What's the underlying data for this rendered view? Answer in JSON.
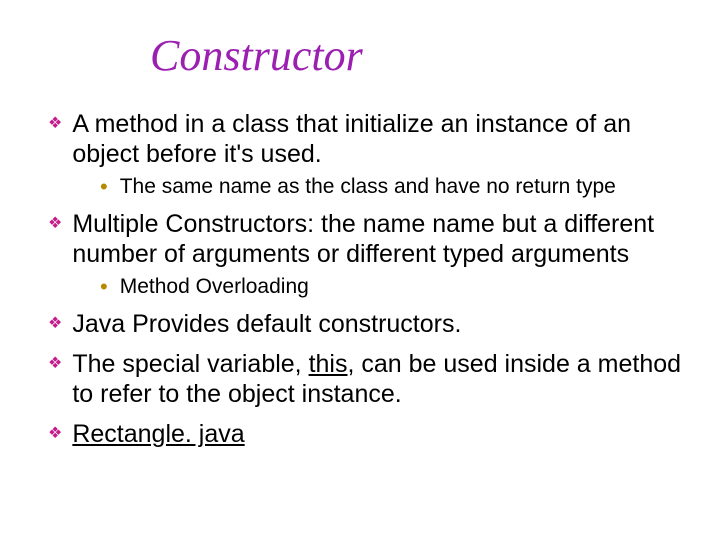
{
  "title": "Constructor",
  "items": [
    {
      "text": "A method in a class that initialize an instance of an object before it's used.",
      "sub": [
        {
          "text": "The same name as the class and have no return type"
        }
      ]
    },
    {
      "text": "Multiple Constructors: the name name but a different number of arguments or different typed arguments",
      "sub": [
        {
          "text": "Method Overloading"
        }
      ]
    },
    {
      "text": "Java Provides default constructors."
    },
    {
      "text_before": "The special variable, ",
      "text_underlined": "this",
      "text_after": ", can be used inside a method to refer to the object instance."
    },
    {
      "text_underlined": "Rectangle. java"
    }
  ],
  "glyphs": {
    "diamond": "❖",
    "dot": "•"
  }
}
